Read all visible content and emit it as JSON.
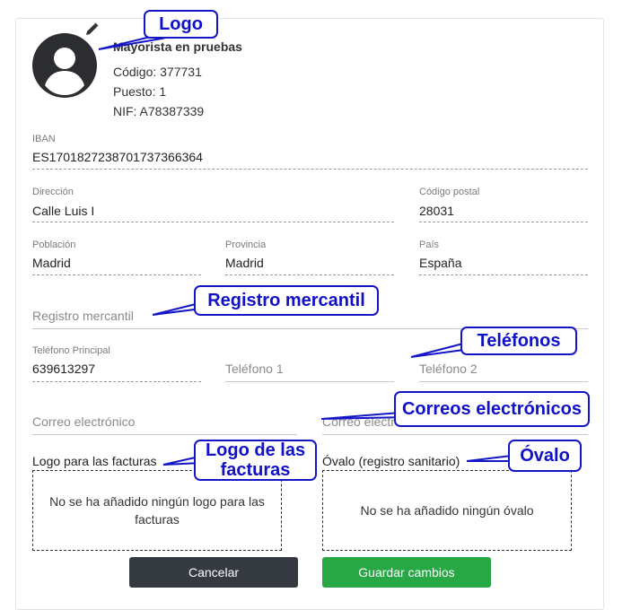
{
  "profile": {
    "name": "Mayorista en pruebas",
    "code": "Código: 377731",
    "position": "Puesto: 1",
    "nif": "NIF: A78387339"
  },
  "fields": {
    "iban": {
      "label": "IBAN",
      "value": "ES1701827238701737366364"
    },
    "address": {
      "label": "Dirección",
      "value": "Calle Luis I"
    },
    "postal_code": {
      "label": "Código postal",
      "value": "28031"
    },
    "city": {
      "label": "Población",
      "value": "Madrid"
    },
    "province": {
      "label": "Provincia",
      "value": "Madrid"
    },
    "country": {
      "label": "País",
      "value": "España"
    },
    "mercantile_registry": {
      "placeholder": "Registro mercantil"
    },
    "phone_main": {
      "label": "Teléfono Principal",
      "value": "639613297"
    },
    "phone_1": {
      "placeholder": "Teléfono 1"
    },
    "phone_2": {
      "placeholder": "Teléfono 2"
    },
    "email_1": {
      "placeholder": "Correo electrónico"
    },
    "email_2": {
      "placeholder": "Correo electrónico"
    }
  },
  "uploads": {
    "invoice_logo": {
      "title": "Logo para las facturas",
      "empty_text": "No se ha añadido ningún logo para las facturas"
    },
    "oval": {
      "title": "Óvalo (registro sanitario)",
      "empty_text": "No se ha añadido ningún óvalo"
    }
  },
  "buttons": {
    "cancel": "Cancelar",
    "save": "Guardar cambios"
  },
  "callouts": {
    "logo": "Logo",
    "registry": "Registro mercantil",
    "phones": "Teléfonos",
    "emails": "Correos electrónicos",
    "invoice_logo": "Logo de las facturas",
    "oval": "Óvalo"
  },
  "colors": {
    "callout": "#1515c8",
    "cancel": "#343a40",
    "save": "#28a745",
    "avatar": "#2b2d31"
  },
  "icons": {
    "avatar": "user-silhouette-icon",
    "edit": "pencil-icon"
  }
}
